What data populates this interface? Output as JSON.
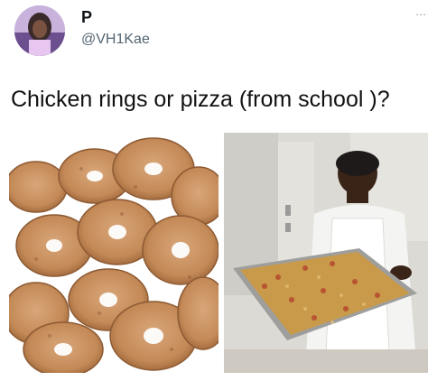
{
  "user": {
    "display_name": "P",
    "handle": "@VH1Kae",
    "avatar_icon": "profile-avatar"
  },
  "menu": {
    "more_label": "..."
  },
  "tweet": {
    "text": "Chicken rings or pizza (from school )?"
  },
  "media": [
    {
      "icon": "chicken-rings-photo"
    },
    {
      "icon": "school-pizza-photo"
    }
  ],
  "colors": {
    "handle": "#536471",
    "text": "#0f1419",
    "ring": "#c98f5e",
    "ring_dark": "#a86a3e",
    "pizza": "#c99a4a"
  }
}
